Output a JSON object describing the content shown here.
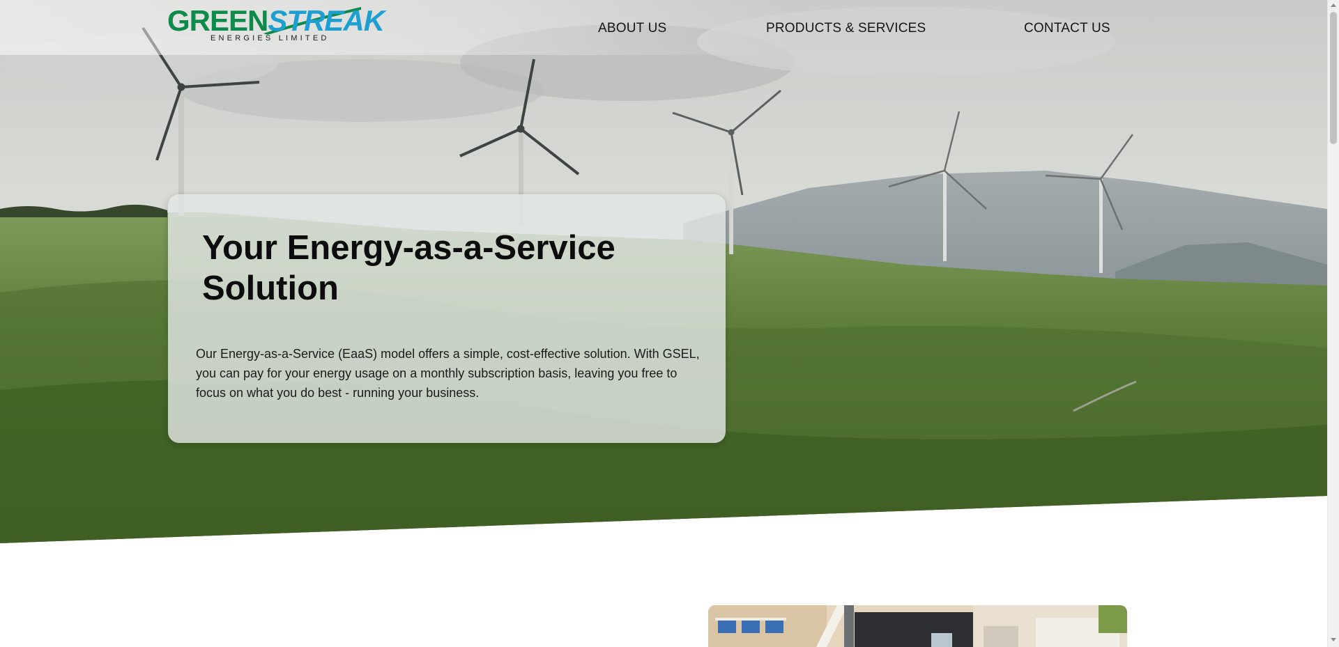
{
  "header": {
    "logo": {
      "word_green": "GREEN",
      "word_blue": "STREAK",
      "subtitle": "ENERGIES LIMITED"
    },
    "nav": [
      {
        "label": "ABOUT US"
      },
      {
        "label": "PRODUCTS & SERVICES"
      },
      {
        "label": "CONTACT US"
      }
    ]
  },
  "hero": {
    "title": "Your Energy-as-a-Service Solution",
    "text": "Our Energy-as-a-Service (EaaS) model offers a simple, cost-effective solution. With GSEL, you can pay for your energy usage on a monthly subscription basis, leaving you free to focus on what you do best - running your business."
  },
  "colors": {
    "brand_green": "#0d8b4a",
    "brand_blue": "#1e9fd1",
    "hero_card": "#e2e6e4"
  }
}
